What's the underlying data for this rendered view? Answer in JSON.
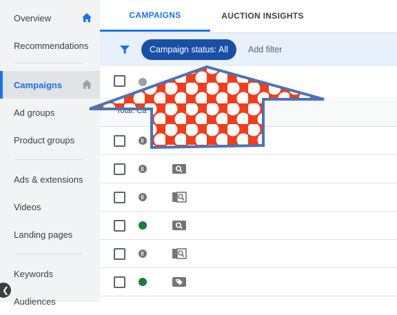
{
  "sidebar": {
    "items": [
      {
        "label": "Overview",
        "icon": "home-icon",
        "active": false
      },
      {
        "label": "Recommendations",
        "active": false
      },
      {
        "label": "Campaigns",
        "icon": "home-icon",
        "active": true
      },
      {
        "label": "Ad groups",
        "active": false
      },
      {
        "label": "Product groups",
        "active": false
      },
      {
        "label": "Ads & extensions",
        "active": false
      },
      {
        "label": "Videos",
        "active": false
      },
      {
        "label": "Landing pages",
        "active": false
      },
      {
        "label": "Keywords",
        "active": false
      },
      {
        "label": "Audiences",
        "active": false
      }
    ],
    "collapse_icon": "chevron-left-icon"
  },
  "tabs": [
    {
      "label": "CAMPAIGNS",
      "selected": true
    },
    {
      "label": "AUCTION INSIGHTS",
      "selected": false
    }
  ],
  "filter": {
    "icon": "filter-icon",
    "chip_label": "Campaign status: All",
    "add_filter_label": "Add filter"
  },
  "table": {
    "total_label": "Total: Ca",
    "rows": [
      {
        "status": "paused",
        "type_icon": null
      },
      {
        "status": "paused",
        "type_icon": "search-campaign-icon"
      },
      {
        "status": "paused",
        "type_icon": "search-network-icon"
      },
      {
        "status": "enabled",
        "type_icon": "search-campaign-icon"
      },
      {
        "status": "paused",
        "type_icon": "search-network-icon"
      },
      {
        "status": "enabled",
        "type_icon": "shopping-tag-icon"
      }
    ]
  },
  "colors": {
    "accent": "#1a73e8",
    "chip": "#1a4fa8",
    "filter_bg": "#e8f0fe",
    "enabled": "#188038",
    "paused": "#757575",
    "overlay_red": "#f23c1c",
    "overlay_outline": "#4a74b8"
  }
}
